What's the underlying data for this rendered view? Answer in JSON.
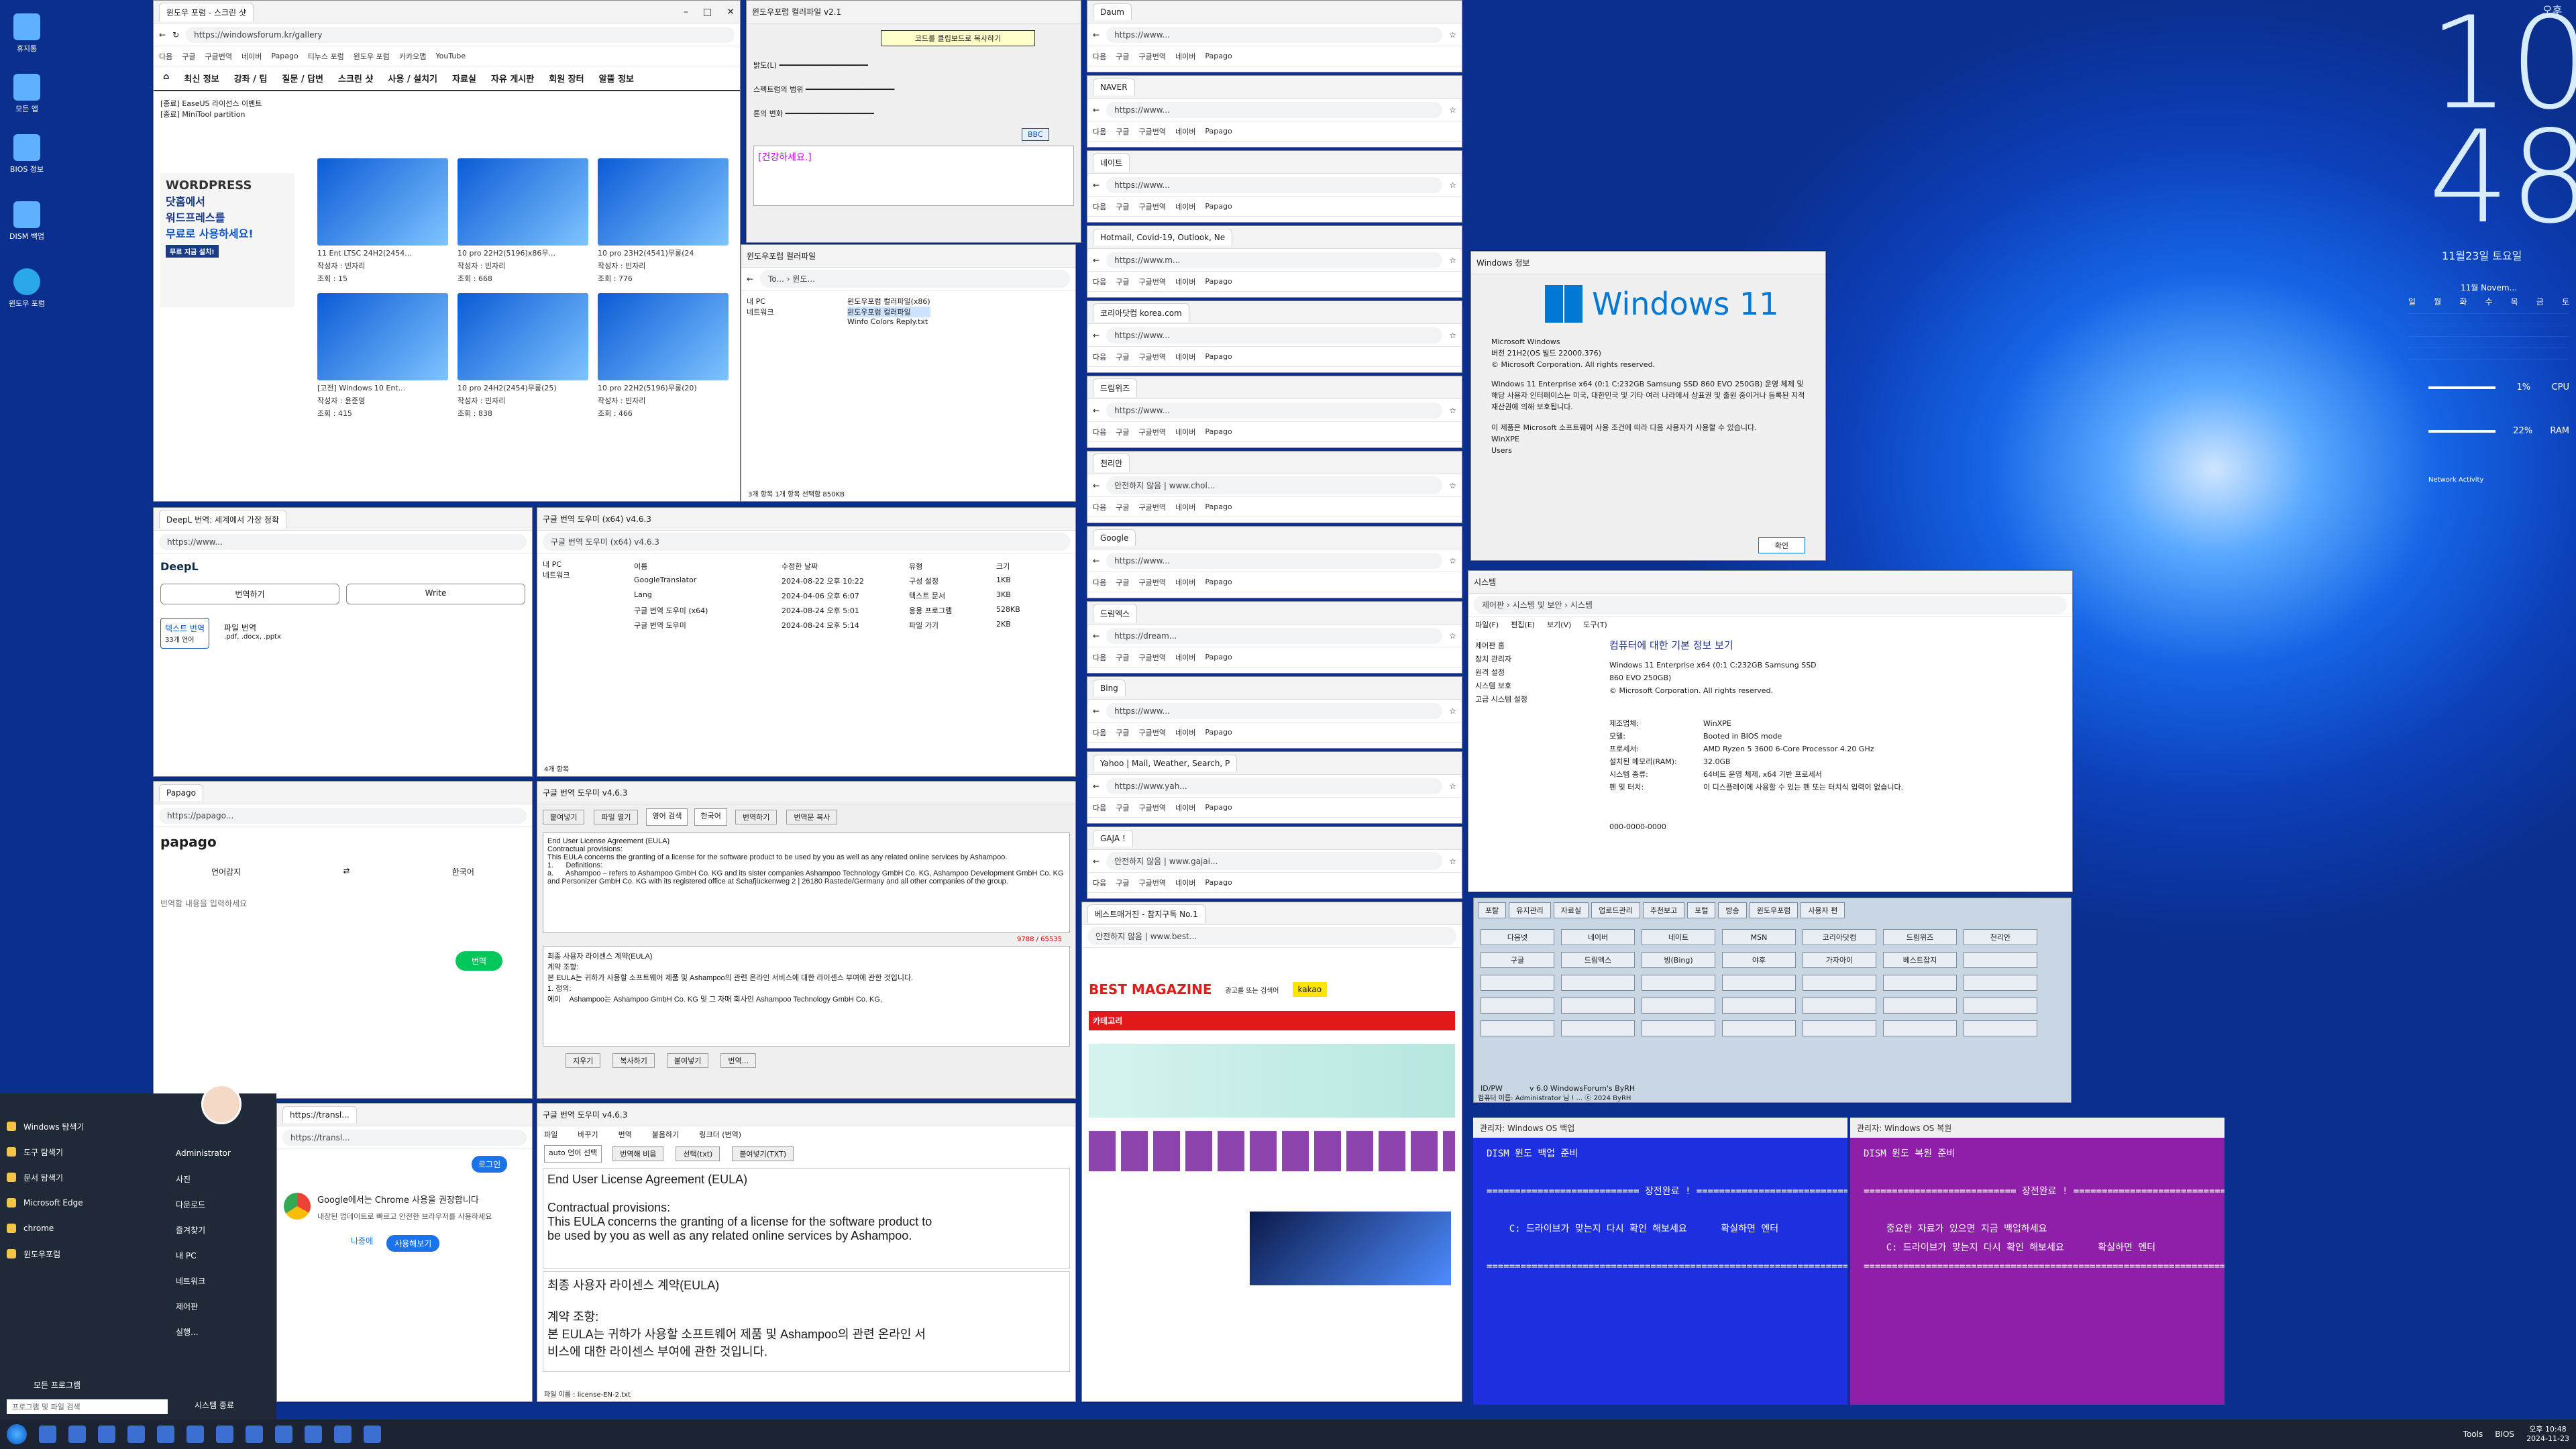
{
  "desktop": {
    "icons": [
      "휴지통",
      "모든 앱",
      "BIOS 정보",
      "DISM 백업",
      "윈도우 포럼"
    ]
  },
  "clock": {
    "hour": "10",
    "minute": "48",
    "ampm": "오후",
    "date": "11월23일 토요일"
  },
  "calendar": {
    "header": "11월 Novem...",
    "weekdays": [
      "일",
      "월",
      "화",
      "수",
      "목",
      "금",
      "토"
    ]
  },
  "sysmon": {
    "cpu": "1%",
    "cpu_label": "CPU",
    "ram": "22%",
    "ram_label": "RAM",
    "net": "Network Activity"
  },
  "win_forum": {
    "tab": "윈도우 포럼 - 스크린 샷",
    "url": "https://windowsforum.kr/gallery",
    "bookmarks": [
      "다음",
      "구글",
      "구글번역",
      "네이버",
      "Papago",
      "티누스 포럼",
      "윈도우 포럼",
      "카카오맵",
      "YouTube"
    ],
    "menu": [
      "최신 정보",
      "강좌 / 팁",
      "질문 / 답변",
      "스크린 샷",
      "사용 / 설치기",
      "자료실",
      "자유 게시판",
      "회원 장터",
      "알뜰 정보"
    ],
    "notice": [
      "[종료] EaseUS 라이선스 이벤트",
      "[종료] MiniTool partition"
    ],
    "gallery": [
      {
        "t": "11 Ent LTSC 24H2(2454...",
        "a": "작성자 : 빈자리",
        "v": "조회 : 15"
      },
      {
        "t": "10 pro 22H2(5196)x86무...",
        "a": "작성자 : 빈자리",
        "v": "조회 : 668"
      },
      {
        "t": "10 pro 23H2(4541)무롱(24",
        "a": "작성자 : 빈자리",
        "v": "조회 : 776"
      },
      {
        "t": "[고전] Windows 10 Ent...",
        "a": "작성자 : 윤준영",
        "v": "조회 : 415"
      },
      {
        "t": "10 pro 24H2(2454)무롱(25)",
        "a": "작성자 : 빈자리",
        "v": "조회 : 838"
      },
      {
        "t": "10 pro 22H2(5196)무롱(20)",
        "a": "작성자 : 빈자리",
        "v": "조회 : 466"
      }
    ],
    "ad": [
      "WORDPRESS",
      "닷홈에서",
      "워드프레스를",
      "무료로 사용하세요!",
      "무료 지금 설치!"
    ]
  },
  "win_clip": {
    "title": "윈도우포럼 컬러파일 v2.1",
    "label": "코드를 클립보드로 복사하기",
    "rows": [
      "밝도(L)",
      "스펙트럼의 범위",
      "톤의 변화"
    ],
    "greet": "[건강하세요.]",
    "code": "BBC"
  },
  "win_explorer1": {
    "title": "윈도우포럼 컬러파일",
    "path": "To... › 윈도...",
    "items": [
      "윈도우포럼 컬러파일(x86)",
      "윈도우포럼 컬러파일",
      "Winfo Colors Reply.txt"
    ],
    "status": "3개 항목    1개 항목 선택함 850KB",
    "nav": [
      "내 PC",
      "네트워크"
    ]
  },
  "win_browsers": [
    {
      "t": "Daum",
      "u": "https://www..."
    },
    {
      "t": "NAVER",
      "u": "https://www..."
    },
    {
      "t": "네이트",
      "u": "https://www..."
    },
    {
      "t": "Hotmail, Covid-19, Outlook, Ne",
      "u": "https://www.m..."
    },
    {
      "t": "코리아닷컴 korea.com",
      "u": "https://www..."
    },
    {
      "t": "드림위즈",
      "u": "https://www..."
    },
    {
      "t": "천리안",
      "u": "안전하지 않음 | www.chol..."
    },
    {
      "t": "Google",
      "u": "https://www..."
    },
    {
      "t": "드림엑스",
      "u": "https://dream..."
    },
    {
      "t": "Bing",
      "u": "https://www..."
    },
    {
      "t": "Yahoo | Mail, Weather, Search, P",
      "u": "https://www.yah..."
    },
    {
      "t": "GAJA !",
      "u": "안전하지 않음 | www.gajai..."
    },
    {
      "t": "베스트매거진 - 참지구독 No.1",
      "u": "안전하지 않음 | www.best..."
    }
  ],
  "win_about": {
    "title": "Windows 정보",
    "logo": "Windows 11",
    "lines": [
      "Microsoft Windows",
      "버전 21H2(OS 빌드 22000.376)",
      "© Microsoft Corporation. All rights reserved.",
      "Windows 11 Enterprise x64 (0:1 C:232GB Samsung SSD 860 EVO 250GB) 운영 체제 및 해당 사용자 인터페이스는 미국, 대한민국 및 기타 여러 나라에서 상표권 및 출원 중이거나 등록된 지적 재산권에 의해 보호됩니다.",
      "이 제품은 Microsoft 소프트웨어 사용 조건에 따라 다음 사용자가 사용할 수 있습니다.",
      "WinXPE",
      "Users"
    ],
    "ok": "확인"
  },
  "win_system": {
    "title": "시스템",
    "path": "제어판 › 시스템 및 보안 › 시스템",
    "heading": "컴퓨터에 대한 기본 정보 보기",
    "menu": [
      "파일(F)",
      "편집(E)",
      "보기(V)",
      "도구(T)"
    ],
    "side": [
      "제어판 홈",
      "장치 관리자",
      "원격 설정",
      "시스템 보호",
      "고급 시스템 설정"
    ],
    "edition": [
      "Windows 11 Enterprise x64 (0:1 C:232GB Samsung SSD 860 EVO 250GB)",
      "© Microsoft Corporation. All rights reserved."
    ],
    "sys": [
      [
        "제조업체:",
        "WinXPE"
      ],
      [
        "모델:",
        "Booted in BIOS mode"
      ],
      [
        "프로세서:",
        "AMD Ryzen 5 3600 6-Core Processor    4.20 GHz"
      ],
      [
        "설치된 메모리(RAM):",
        "32.0GB"
      ],
      [
        "시스템 종류:",
        "64비트 운영 체제, x64 기반 프로세서"
      ],
      [
        "펜 및 터치:",
        "이 디스플레이에 사용할 수 있는 펜 또는 터치식 입력이 없습니다."
      ]
    ],
    "product": "WinXPE 지원",
    "phone": "000-0000-0000"
  },
  "win_launcher": {
    "tabs": [
      "포탈",
      "유지관리",
      "자료실",
      "업로드관리",
      "추천보고",
      "포털",
      "방송",
      "윈도우포럼",
      "사용자 편"
    ],
    "buttons": [
      "다음넷",
      "네이버",
      "네이트",
      "MSN",
      "코리아닷컴",
      "드림위즈",
      "천리안",
      "구글",
      "드림엑스",
      "빙(Bing)",
      "야후",
      "가자아이",
      "베스트잡지"
    ],
    "status": "ID/PW",
    "ver": "v 6.0  WindowsForum's ByRH",
    "footer": "컴퓨터 이름: Administrator 님 ! ... ⓒ 2024 ByRH"
  },
  "win_deepl": {
    "tab": "DeepL 번역: 세계에서 가장 정확",
    "btn1": "번역하기",
    "btn2": "Write",
    "opt1": "텍스트 번역",
    "opt1s": "33개 언어",
    "opt2": "파일 번역",
    "opt2s": ".pdf, .docx, .pptx"
  },
  "win_explorer2": {
    "title": "구글 번역 도우미 (x64) v4.6.3",
    "nav": [
      "내 PC",
      "네트워크"
    ],
    "cols": [
      "이름",
      "수정한 날짜",
      "유형",
      "크기"
    ],
    "files": [
      [
        "GoogleTranslator",
        "2024-08-22 오후 10:22",
        "구성 설정",
        "1KB"
      ],
      [
        "Lang",
        "2024-04-06 오후 6:07",
        "텍스트 문서",
        "3KB"
      ],
      [
        "구글 번역 도우미 (x64)",
        "2024-08-24 오후 5:01",
        "응용 프로그램",
        "528KB"
      ],
      [
        "구글 번역 도우미",
        "2024-08-24 오후 5:14",
        "파일 가기",
        "2KB"
      ]
    ],
    "status": "4개 항목"
  },
  "win_papago": {
    "tab": "Papago",
    "logo": "papago",
    "lang1": "언어감지",
    "lang2": "한국어",
    "placeholder": "번역할 내용을 입력하세요",
    "btn": "번역"
  },
  "win_trans1": {
    "title": "구글 번역 도우미 v4.6.3",
    "btns": [
      "붙여넣기",
      "파일 열기",
      "번역하기",
      "번역문 복사"
    ],
    "src": "영어 검색",
    "dst": "한국어",
    "en": "End User License Agreement (EULA)\nContractual provisions:\nThis EULA concerns the granting of a license for the software product to be used by you as well as any related online services by Ashampoo.\n1.      Definitions:\na.      Ashampoo – refers to Ashampoo GmbH Co. KG and its sister companies Ashampoo Technology GmbH Co. KG, Ashampoo Development GmbH Co. KG and Personizer GmbH Co. KG with its registered office at Schafjückenweg 2 | 26180 Rastede/Germany and all other companies of the group.",
    "ko": "최종 사용자 라이센스 계약(EULA)\n계약 조항:\n본 EULA는 귀하가 사용할 소프트웨어 제품 및 Ashampoo의 관련 온라인 서비스에 대한 라이센스 부여에 관한 것입니다.\n1. 정의:\n에이    Ashampoo는 Ashampoo GmbH Co. KG 및 그 자매 회사인 Ashampoo Technology GmbH Co. KG,",
    "count": "9788 / 65535",
    "bottom": [
      "지우기",
      "복사하기",
      "붙여넣기",
      "번역..."
    ]
  },
  "win_trans2": {
    "title": "구글 번역 도우미 v4.6.3",
    "menu": [
      "파일",
      "바꾸기",
      "번역",
      "붙음하기",
      "링크더 (번역)"
    ],
    "lang": "auto  언어 선택",
    "btns": [
      "번역해 비움",
      "선택(txt)",
      "붙여넣기(TXT)"
    ],
    "en": "End User License Agreement (EULA)\n\nContractual provisions:\nThis EULA concerns the granting of a license for the software product to\nbe used by you as well as any related online services by Ashampoo.",
    "ko": "최종 사용자 라이센스 계약(EULA)\n\n계약 조항:\n본 EULA는 귀하가 사용할 소프트웨어 제품 및 Ashampoo의 관련 온라인 서\n비스에 대한 라이센스 부여에 관한 것입니다.",
    "file": "파일 이름 : license-EN-2.txt"
  },
  "win_chrome": {
    "tab": "https://transl...",
    "msg": "Google에서는 Chrome 사용을 권장합니다",
    "sub": "내장된 업데이트로 빠르고 안전한 브라우저를 사용하세요",
    "later": "나중에",
    "use": "사용해보기",
    "login": "로그인"
  },
  "win_best": {
    "logo": "BEST MAGAZINE",
    "kakao": "kakao",
    "cat": "카테고리",
    "search": "광고를 또는 검색어"
  },
  "cmd1": {
    "title": "관리자: Windows OS 백업",
    "lines": [
      "DISM 윈도 백업 준비",
      "",
      "=========================== 장전완료 ! ===========================",
      "",
      "    C: 드라이브가 맞는지 다시 확인 해보세요      확실하면 엔터",
      "",
      "================================================================="
    ]
  },
  "cmd2": {
    "title": "관리자: Windows OS 복원",
    "lines": [
      "DISM 윈도 복원 준비",
      "",
      "=========================== 장전완료 ! ===========================",
      "",
      "    중요한 자료가 있으면 지금 백업하세요",
      "    C: 드라이브가 맞는지 다시 확인 해보세요      확실하면 엔터",
      "================================================================="
    ]
  },
  "startmenu": {
    "left": [
      "Windows 탐색기",
      "도구 탐색기",
      "문서 탐색기",
      "Microsoft Edge",
      "chrome",
      "윈도우포럼"
    ],
    "right": [
      "Administrator",
      "사진",
      "다운로드",
      "즐겨찾기",
      "내 PC",
      "네트워크",
      "제어판",
      "실행..."
    ],
    "all": "모든 프로그램",
    "search": "프로그램 및 파일 검색",
    "power": "시스템 종료"
  },
  "taskbar": {
    "tray": [
      "Tools",
      "BIOS"
    ],
    "time": "오후 10:48",
    "date": "2024-11-23"
  }
}
